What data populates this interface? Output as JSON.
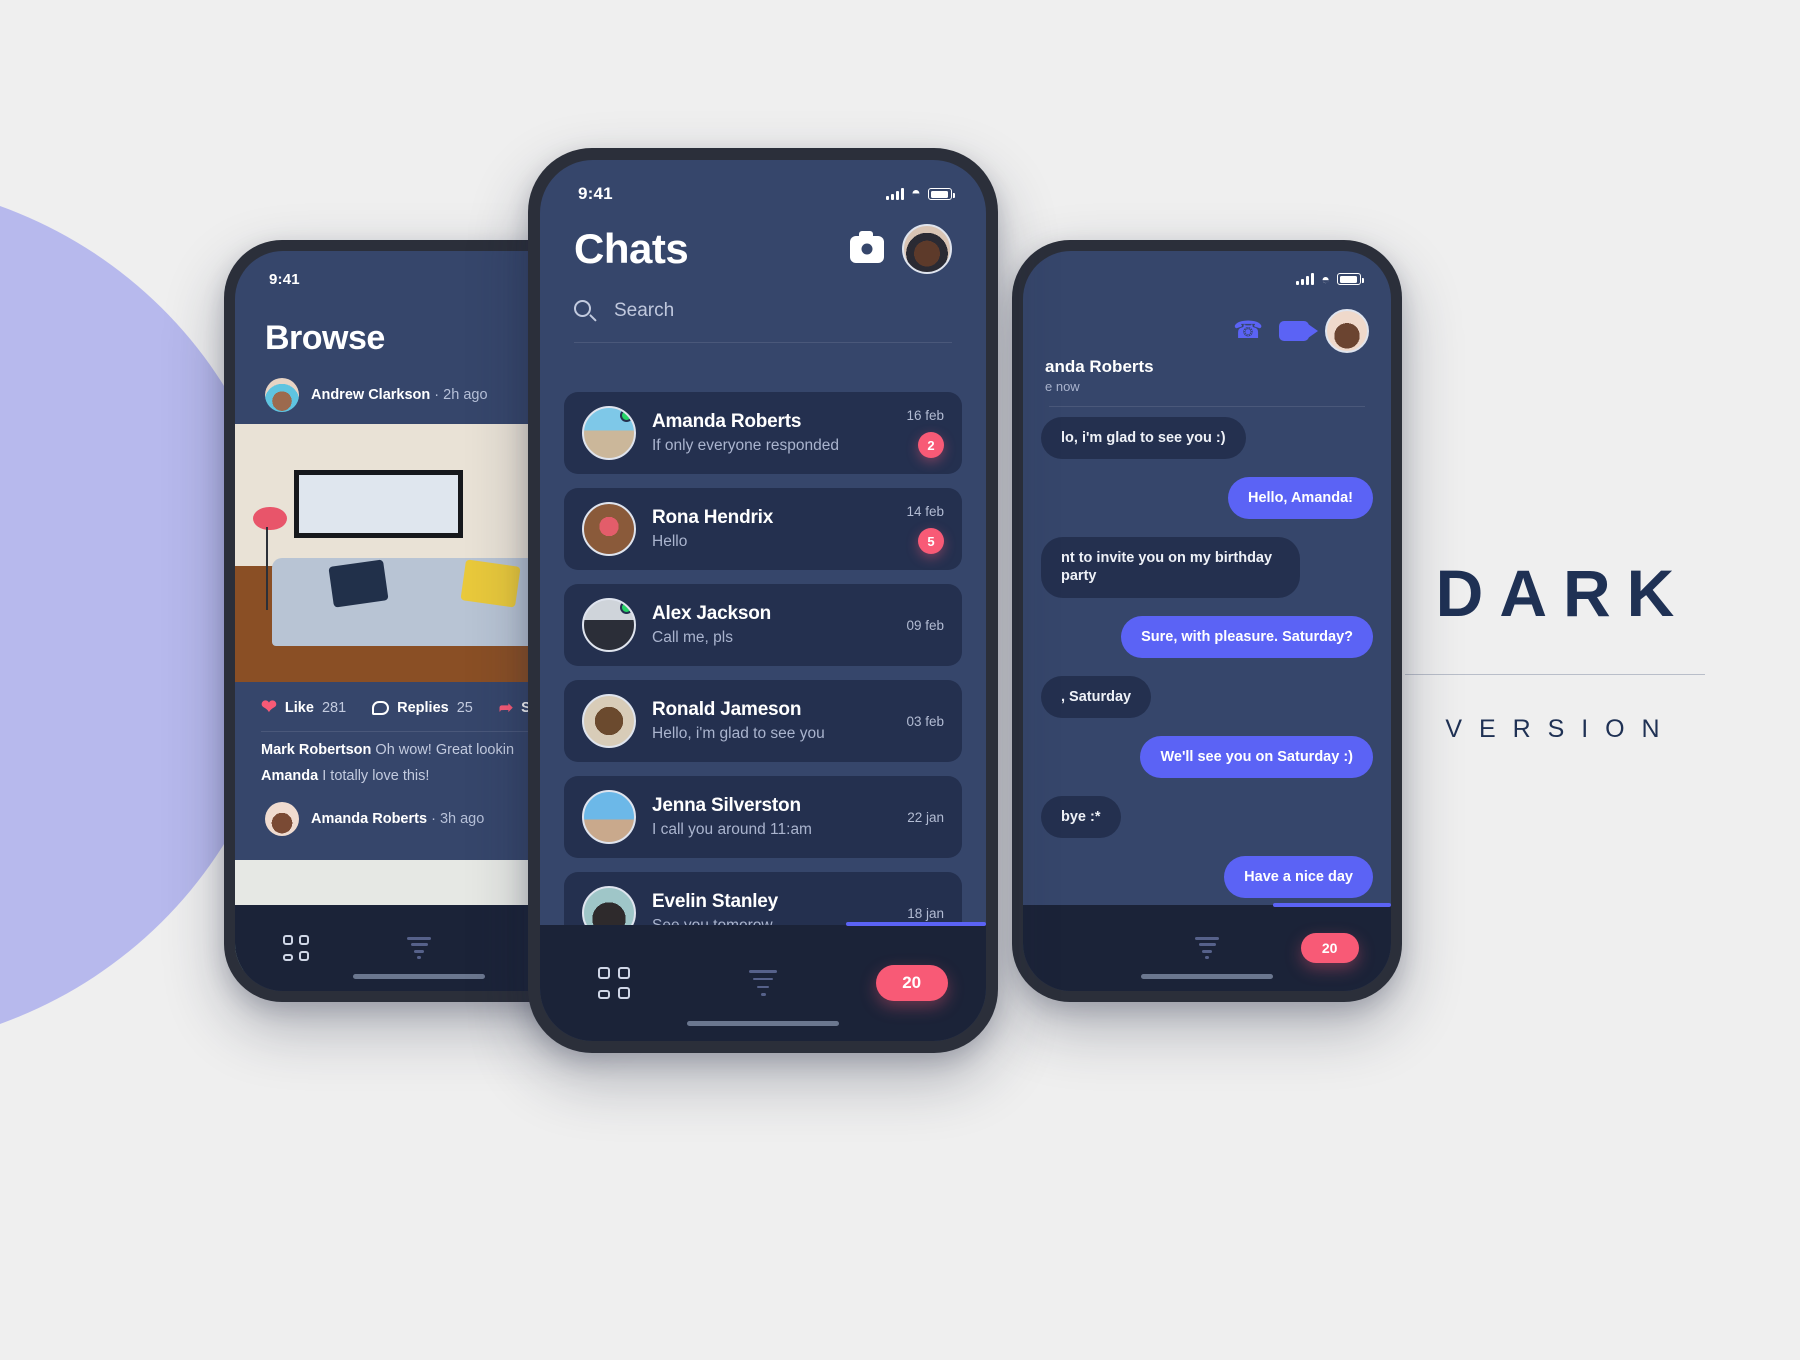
{
  "canvas": {
    "bg": "#efefef",
    "blob_color": "#b7b9ed"
  },
  "branding": {
    "title": "DARK",
    "subtitle": "V E R S I O N"
  },
  "status_bar": {
    "time": "9:41",
    "icons": [
      "signal-icon",
      "wifi-icon",
      "battery-icon"
    ]
  },
  "browse_screen": {
    "title": "Browse",
    "post1": {
      "author": "Andrew Clarkson",
      "separator": "·",
      "time": "2h ago",
      "like_label": "Like",
      "like_count": "281",
      "replies_label": "Replies",
      "replies_count": "25",
      "share_label": "Sh",
      "comments": [
        {
          "author": "Mark Robertson",
          "text": "Oh wow! Great lookin"
        },
        {
          "author": "Amanda",
          "text": "I totally love this!"
        }
      ]
    },
    "post2": {
      "author": "Amanda Roberts",
      "separator": "·",
      "time": "3h ago"
    },
    "tabs": [
      {
        "name": "grid-icon"
      },
      {
        "name": "filter-icon"
      }
    ]
  },
  "chats_screen": {
    "title": "Chats",
    "camera_icon": "camera-icon",
    "avatar": "profile-avatar",
    "search": {
      "placeholder": "Search",
      "icon": "search-icon"
    },
    "items": [
      {
        "name": "Amanda Roberts",
        "preview": "If only everyone responded",
        "date": "16 feb",
        "badge": "2",
        "online": true
      },
      {
        "name": "Rona Hendrix",
        "preview": "Hello",
        "date": "14 feb",
        "badge": "5",
        "online": false
      },
      {
        "name": "Alex Jackson",
        "preview": "Call me, pls",
        "date": "09 feb",
        "badge": "",
        "online": true
      },
      {
        "name": "Ronald Jameson",
        "preview": "Hello, i'm glad to see you",
        "date": "03 feb",
        "badge": "",
        "online": false
      },
      {
        "name": "Jenna Silverston",
        "preview": "I call you around 11:am",
        "date": "22 jan",
        "badge": "",
        "online": false
      },
      {
        "name": "Evelin Stanley",
        "preview": "See you tomorow",
        "date": "18 jan",
        "badge": "",
        "online": false
      }
    ],
    "tabs": [
      {
        "name": "grid-icon"
      },
      {
        "name": "filter-icon"
      },
      {
        "name": "count-pill",
        "label": "20"
      }
    ]
  },
  "conversation_screen": {
    "contact_name": "anda Roberts",
    "contact_status": "e now",
    "call_icon": "phone-icon",
    "video_icon": "video-camera-icon",
    "avatar": "contact-avatar",
    "messages": [
      {
        "from": "them",
        "text": "lo, i'm glad to see you :)"
      },
      {
        "from": "me",
        "text": "Hello, Amanda!"
      },
      {
        "from": "them",
        "text": "nt to invite you on my birthday party"
      },
      {
        "from": "me",
        "text": "Sure, with pleasure. Saturday?"
      },
      {
        "from": "them",
        "text": ", Saturday"
      },
      {
        "from": "me",
        "text": "We'll see you on Saturday :)"
      },
      {
        "from": "them",
        "text": "bye :*"
      },
      {
        "from": "me",
        "text": "Have a nice day"
      }
    ],
    "tabs": [
      {
        "name": "filter-icon"
      },
      {
        "name": "count-pill",
        "label": "20"
      }
    ]
  },
  "colors": {
    "screen_bg": "#36466b",
    "card_bg": "#24304f",
    "tabbar_bg": "#1b2338",
    "accent_blue": "#5b63f5",
    "accent_pink": "#f85a76",
    "online_green": "#25d366",
    "brand_navy": "#1f3154"
  }
}
